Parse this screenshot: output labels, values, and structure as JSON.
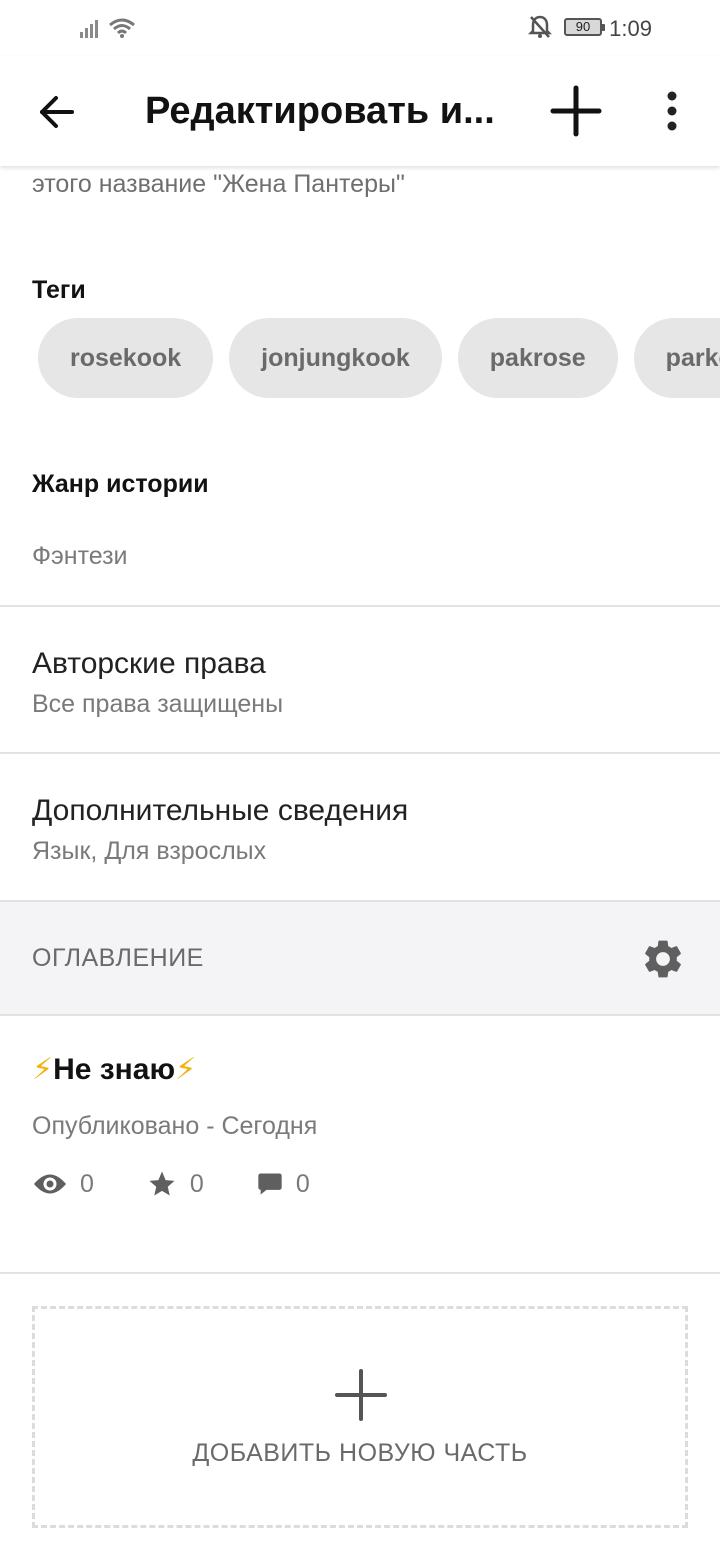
{
  "status_bar": {
    "battery": "90",
    "time": "1:09"
  },
  "app_bar": {
    "title": "Редактировать и...",
    "back_icon": "arrow-left-icon",
    "add_icon": "plus-icon",
    "more_icon": "more-vertical-icon"
  },
  "description_tail": "этого название \"Жена Пантеры\"",
  "tags": {
    "heading": "Теги",
    "items": [
      "rosekook",
      "jonjungkook",
      "pakrose",
      "parkc"
    ]
  },
  "genre": {
    "heading": "Жанр истории",
    "value": "Фэнтези"
  },
  "copyright": {
    "title": "Авторские права",
    "subtitle": "Все права защищены"
  },
  "extra_info": {
    "title": "Дополнительные сведения",
    "subtitle": "Язык, Для взрослых"
  },
  "toc": {
    "label": "ОГЛАВЛЕНИЕ",
    "settings_icon": "gear-icon"
  },
  "part": {
    "bolt": "⚡",
    "title": "Не знаю",
    "status": "Опубликовано - Сегодня",
    "views": "0",
    "votes": "0",
    "comments": "0"
  },
  "add_part": {
    "label": "ДОБАВИТЬ НОВУЮ ЧАСТЬ"
  },
  "colors": {
    "accent_bolt": "#f3b20c",
    "tag_bg": "#e6e6e6",
    "toc_bg": "#f4f3f5"
  }
}
